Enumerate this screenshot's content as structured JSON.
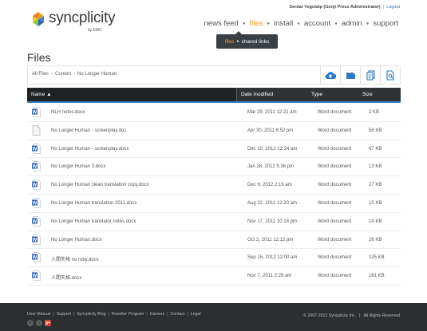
{
  "header": {
    "logo_text": "syncplicity",
    "logo_sub": "by EMC",
    "user_label": "Serdar Yegulalp (Genji Press Administrator)",
    "logout_label": "Logout"
  },
  "nav": {
    "items": [
      {
        "label": "news feed",
        "active": false
      },
      {
        "label": "files",
        "active": true
      },
      {
        "label": "install",
        "active": false
      },
      {
        "label": "account",
        "active": false
      },
      {
        "label": "admin",
        "active": false
      },
      {
        "label": "support",
        "active": false
      }
    ]
  },
  "subnav": {
    "active": "files",
    "other": "shared links"
  },
  "page": {
    "title": "Files"
  },
  "breadcrumb": [
    "All Files",
    "Current",
    "No Longer Human"
  ],
  "toolbar": {
    "icons": [
      "cloud-upload-icon",
      "new-folder-icon",
      "copy-document-icon",
      "document-search-icon"
    ]
  },
  "table": {
    "headers": {
      "name": "Name ▲",
      "date": "Date modified",
      "type": "Type",
      "size": "Size"
    },
    "rows": [
      {
        "name": "NLH notes.docx",
        "date": "Mar 29, 2011 12:21 am",
        "type": "Word document",
        "size": "2 KB",
        "icon": "word-doc-icon"
      },
      {
        "name": "No Longer Human - screenplay.doc",
        "date": "Apr 30, 2011 6:52 pm",
        "type": "Word document",
        "size": "58 KB",
        "icon": "generic-doc-icon"
      },
      {
        "name": "No Longer Human - screenplay.docx",
        "date": "Dec 10, 2012 12:24 am",
        "type": "Word document",
        "size": "67 KB",
        "icon": "word-doc-icon"
      },
      {
        "name": "No Longer Human 3.docx",
        "date": "Jan 28, 2012 5:36 pm",
        "type": "Word document",
        "size": "13 KB",
        "icon": "word-doc-icon"
      },
      {
        "name": "No Longer Human clean translation copy.docx",
        "date": "Dec 9, 2012 2:16 am",
        "type": "Word document",
        "size": "27 KB",
        "icon": "word-doc-icon"
      },
      {
        "name": "No Longer Human translation 2011.docx",
        "date": "Aug 22, 2011 12:20 am",
        "type": "Word document",
        "size": "15 KB",
        "icon": "word-doc-icon"
      },
      {
        "name": "No Longer Human translator notes.docx",
        "date": "Nov 17, 2011 10:18 pm",
        "type": "Word document",
        "size": "14 KB",
        "icon": "word-doc-icon"
      },
      {
        "name": "No Longer Human.docx",
        "date": "Oct 2, 2011 12:12 pm",
        "type": "Word document",
        "size": "26 KB",
        "icon": "word-doc-icon"
      },
      {
        "name": "人間失格 no ruby.docx",
        "date": "Sep 15, 2012 12:00 am",
        "type": "Word document",
        "size": "125 KB",
        "icon": "word-doc-icon"
      },
      {
        "name": "人間失格.docx",
        "date": "Nov 7, 2011 2:29 am",
        "type": "Word document",
        "size": "161 KB",
        "icon": "word-doc-icon"
      }
    ]
  },
  "footer": {
    "links": [
      "User Manual",
      "Support",
      "Syncplicity Blog",
      "Reseller Program",
      "Careers",
      "Contact",
      "Legal"
    ],
    "copyright": "© 2007-2013 Syncplicity Inc.",
    "rights": "All Rights Reserved",
    "social": [
      "f",
      "t",
      "g+"
    ]
  },
  "colors": {
    "accent": "#e8a21b",
    "header_bg": "#2f3336",
    "selection_line": "#3d7fc1",
    "footer_bg": "#2c2f31"
  }
}
